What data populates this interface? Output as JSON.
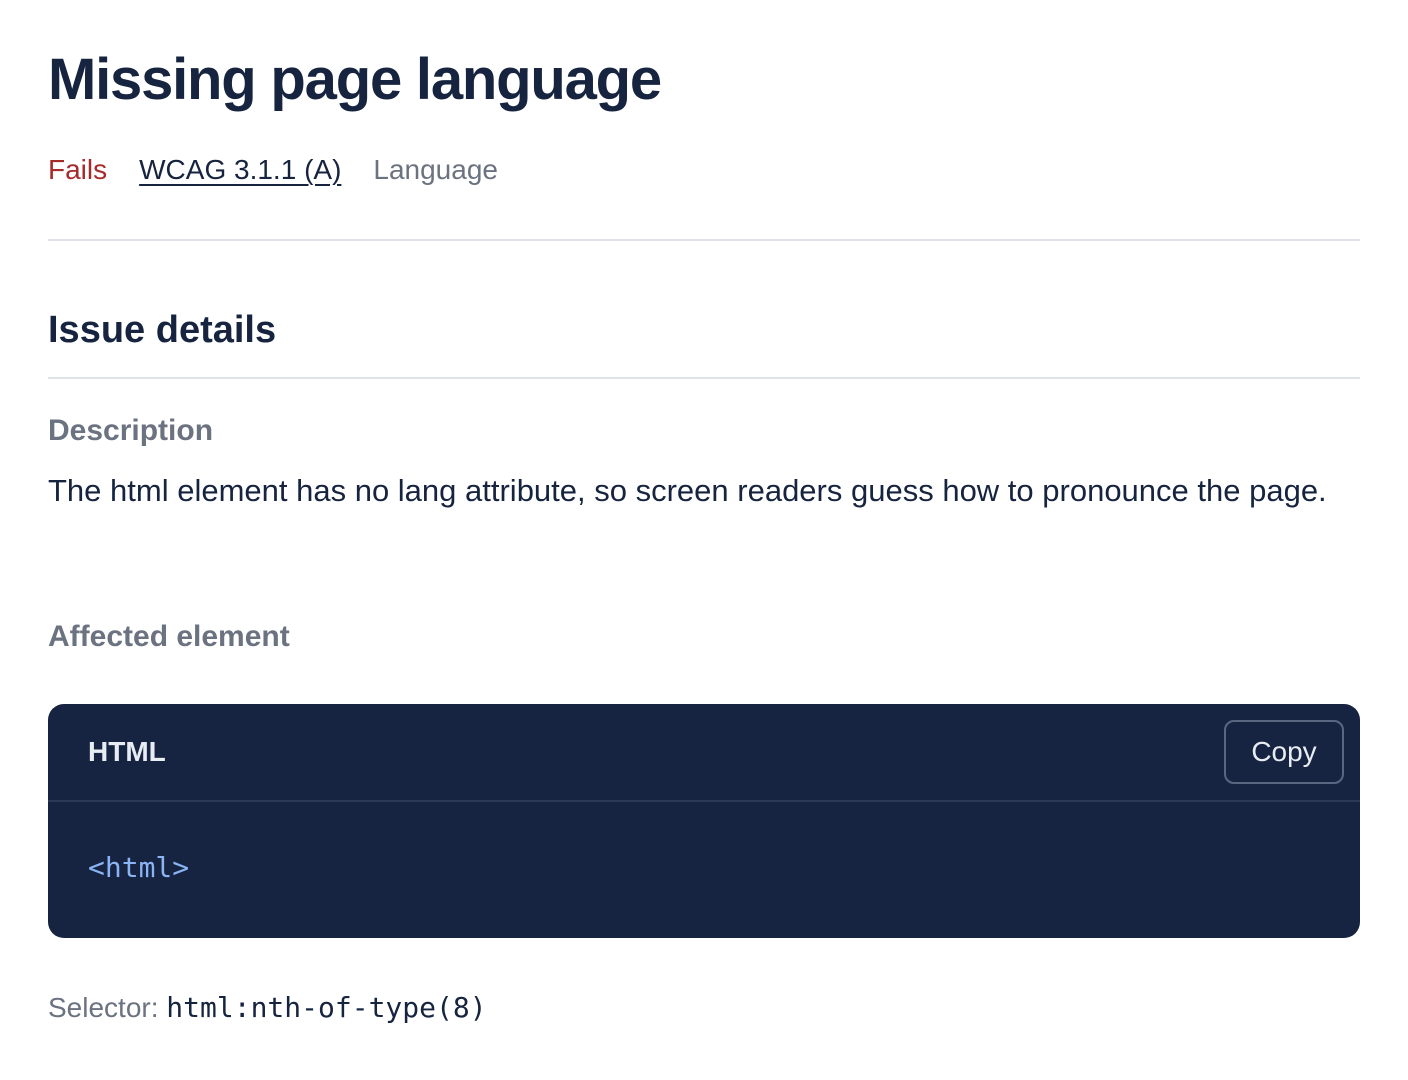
{
  "issue": {
    "title": "Missing page language",
    "status": "Fails",
    "wcag_link": "WCAG 3.1.1 (A)",
    "category": "Language"
  },
  "details": {
    "section_title": "Issue details",
    "description_label": "Description",
    "description_text": "The html element has no lang attribute, so screen readers guess how to pronounce the page.",
    "affected_label": "Affected element"
  },
  "code_block": {
    "language": "HTML",
    "copy_label": "Copy",
    "code": "<html>"
  },
  "selector": {
    "label": "Selector:",
    "value": "html:nth-of-type(8)"
  },
  "colors": {
    "fail": "#a52a2a",
    "text": "#16243f",
    "muted": "#6b7280",
    "code_bg": "#172441",
    "code_text": "#8bb4f4"
  }
}
